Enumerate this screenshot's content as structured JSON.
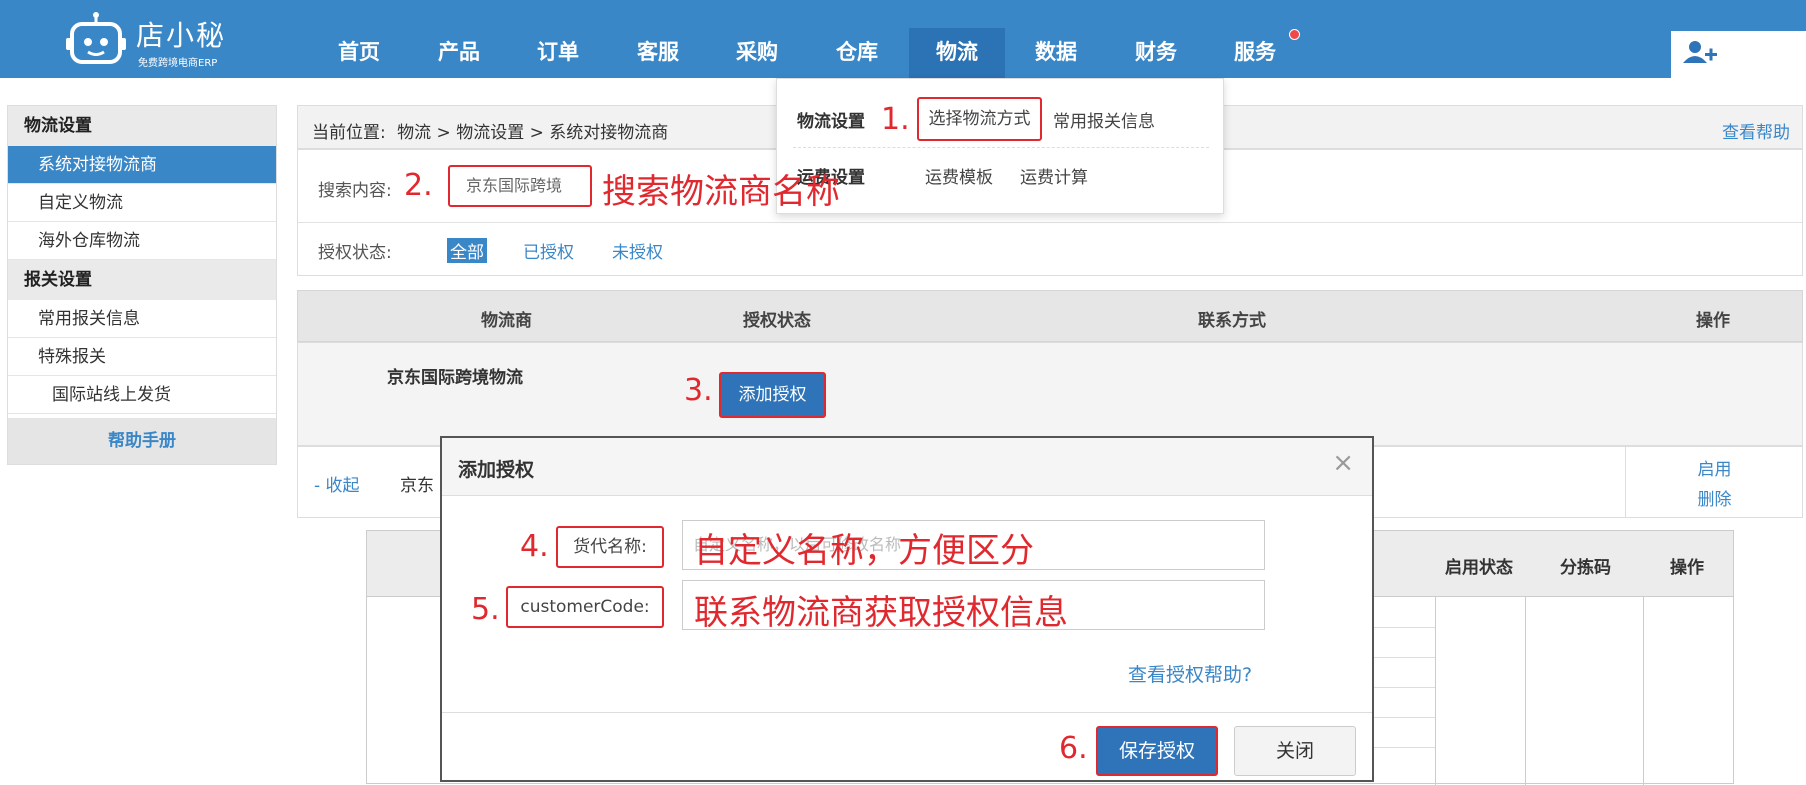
{
  "brand": {
    "title": "店小秘",
    "subtitle": "免费跨境电商ERP"
  },
  "nav": {
    "items": [
      "首页",
      "产品",
      "订单",
      "客服",
      "采购",
      "仓库",
      "物流",
      "数据",
      "财务",
      "服务"
    ],
    "active_index": 6
  },
  "sidebar": {
    "section1": "物流设置",
    "items1": [
      "系统对接物流商",
      "自定义物流",
      "海外仓库物流"
    ],
    "section2": "报关设置",
    "items2": [
      "常用报关信息",
      "特殊报关",
      "国际站线上发货"
    ],
    "help": "帮助手册"
  },
  "breadcrumb": {
    "label": "当前位置:",
    "path": "物流 > 物流设置 > 系统对接物流商",
    "help": "查看帮助"
  },
  "filter": {
    "search_label": "搜索内容:",
    "search_value": "京东国际跨境",
    "auth_label": "授权状态:",
    "auth_options": [
      "全部",
      "已授权",
      "未授权"
    ]
  },
  "table": {
    "headers": [
      "物流商",
      "授权状态",
      "联系方式",
      "操作"
    ],
    "row": {
      "name": "京东国际跨境物流",
      "button": "添加授权"
    },
    "row2": {
      "collapse": "- 收起",
      "text": "京东",
      "ops": [
        "启用",
        "删除"
      ]
    }
  },
  "inner_table": {
    "headers": [
      "启用状态",
      "分拣码",
      "操作"
    ]
  },
  "dropdown": {
    "group1": {
      "title": "物流设置",
      "links": [
        "选择物流方式",
        "常用报关信息"
      ]
    },
    "group2": {
      "title": "运费设置",
      "links": [
        "运费模板",
        "运费计算"
      ]
    }
  },
  "modal": {
    "title": "添加授权",
    "close": "×",
    "field1_label": "货代名称:",
    "field1_placeholder": "自定义名称，以后可修改名称",
    "field2_label": "customerCode:",
    "auth_help": "查看授权帮助?",
    "save": "保存授权",
    "close_btn": "关闭"
  },
  "annotations": {
    "n1": "1.",
    "n2": "2.",
    "n3": "3.",
    "n4": "4.",
    "n5": "5.",
    "n6": "6.",
    "search_note": "搜索物流商名称",
    "field1_note": "自定义名称，方便区分",
    "field2_note": "联系物流商获取授权信息"
  },
  "colors": {
    "primary": "#3a87c8",
    "annotation": "#e0292f"
  }
}
